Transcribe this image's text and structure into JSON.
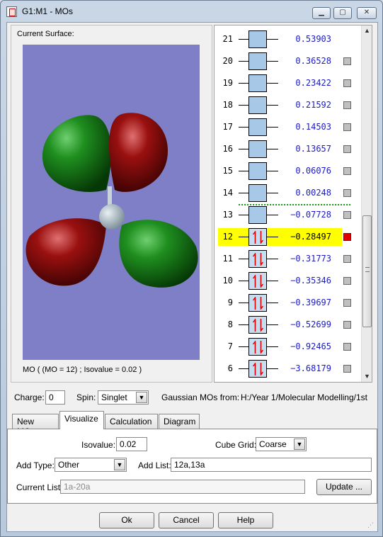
{
  "window": {
    "title": "G1:M1 - MOs"
  },
  "surface": {
    "label": "Current Surface:",
    "caption": "MO ( (MO = 12) ; Isovalue = 0.02 )"
  },
  "orbitals": [
    {
      "n": "21",
      "energy": "0.53903",
      "occ": false,
      "checked": false,
      "selected": false
    },
    {
      "n": "20",
      "energy": "0.36528",
      "occ": false,
      "checked": false,
      "selected": false
    },
    {
      "n": "19",
      "energy": "0.23422",
      "occ": false,
      "checked": false,
      "selected": false
    },
    {
      "n": "18",
      "energy": "0.21592",
      "occ": false,
      "checked": false,
      "selected": false
    },
    {
      "n": "17",
      "energy": "0.14503",
      "occ": false,
      "checked": false,
      "selected": false
    },
    {
      "n": "16",
      "energy": "0.13657",
      "occ": false,
      "checked": false,
      "selected": false
    },
    {
      "n": "15",
      "energy": "0.06076",
      "occ": false,
      "checked": false,
      "selected": false
    },
    {
      "n": "14",
      "energy": "0.00248",
      "occ": false,
      "checked": false,
      "selected": false
    },
    {
      "n": "13",
      "energy": "−0.07728",
      "occ": false,
      "checked": false,
      "selected": false
    },
    {
      "n": "12",
      "energy": "−0.28497",
      "occ": true,
      "checked": true,
      "selected": true
    },
    {
      "n": "11",
      "energy": "−0.31773",
      "occ": true,
      "checked": false,
      "selected": false
    },
    {
      "n": "10",
      "energy": "−0.35346",
      "occ": true,
      "checked": false,
      "selected": false
    },
    {
      "n": "9",
      "energy": "−0.39697",
      "occ": true,
      "checked": false,
      "selected": false
    },
    {
      "n": "8",
      "energy": "−0.52699",
      "occ": true,
      "checked": false,
      "selected": false
    },
    {
      "n": "7",
      "energy": "−0.92465",
      "occ": true,
      "checked": false,
      "selected": false
    },
    {
      "n": "6",
      "energy": "−3.68179",
      "occ": true,
      "checked": false,
      "selected": false
    }
  ],
  "charge": {
    "label": "Charge:",
    "value": "0"
  },
  "spin": {
    "label": "Spin:",
    "value": "Singlet"
  },
  "source": {
    "label": "Gaussian MOs from:",
    "path": "H:/Year 1/Molecular Modelling/1st"
  },
  "tabs": [
    "New MOs",
    "Visualize",
    "Calculation",
    "Diagram"
  ],
  "visualize": {
    "isovalue_label": "Isovalue:",
    "isovalue": "0.02",
    "cube_grid_label": "Cube Grid:",
    "cube_grid": "Coarse",
    "add_type_label": "Add Type:",
    "add_type": "Other",
    "add_list_label": "Add List:",
    "add_list": "12a,13a",
    "current_list_label": "Current List:",
    "current_list": "1a-20a",
    "update_button": "Update ..."
  },
  "buttons": {
    "ok": "Ok",
    "cancel": "Cancel",
    "help": "Help"
  },
  "colors": {
    "background_surface": "#7f7fc8",
    "lobe_green": "#1a7a1a",
    "lobe_red": "#8a0f0f",
    "selected_highlight": "#ffff00",
    "energy_text": "#1a1ac8"
  }
}
